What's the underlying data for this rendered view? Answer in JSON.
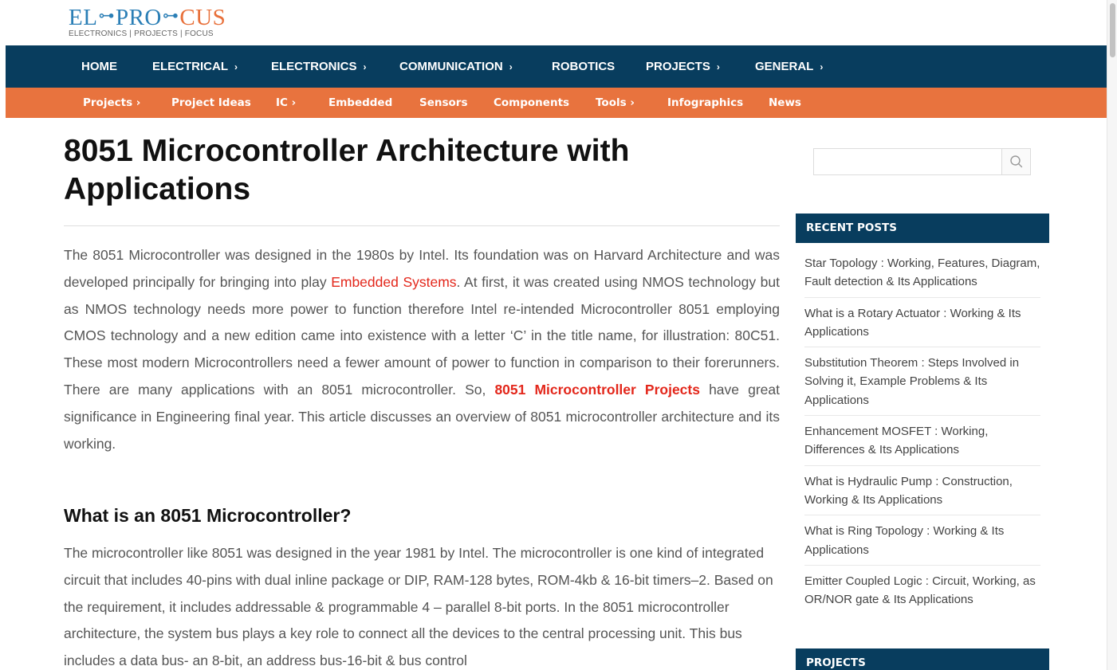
{
  "logo": {
    "part1": "EL",
    "part2": "PRO",
    "part3": "CUS",
    "tagline": "ELECTRONICS | PROJECTS | FOCUS"
  },
  "main_nav": {
    "items": [
      {
        "label": "HOME",
        "has_submenu": false
      },
      {
        "label": "ELECTRICAL",
        "has_submenu": true
      },
      {
        "label": "ELECTRONICS",
        "has_submenu": true
      },
      {
        "label": "COMMUNICATION",
        "has_submenu": true
      },
      {
        "label": "ROBOTICS",
        "has_submenu": false
      },
      {
        "label": "PROJECTS",
        "has_submenu": true
      },
      {
        "label": "GENERAL",
        "has_submenu": true
      }
    ],
    "chevron": "›"
  },
  "sub_nav": {
    "items": [
      {
        "label": "Projects ›"
      },
      {
        "label": "Project Ideas"
      },
      {
        "label": "IC ›"
      },
      {
        "label": "Embedded"
      },
      {
        "label": "Sensors"
      },
      {
        "label": "Components"
      },
      {
        "label": "Tools ›"
      },
      {
        "label": "Infographics"
      },
      {
        "label": "News"
      }
    ]
  },
  "article": {
    "title": "8051 Microcontroller Architecture with Applications",
    "intro": {
      "text1": "The 8051 Microcontroller was designed in the 1980s by Intel. Its foundation was on Harvard Architecture and was developed principally for bringing into play ",
      "link1": "Embedded Systems",
      "text2": ". At first, it was created using NMOS technology but as NMOS technology needs more power to function therefore Intel re-intended Microcontroller 8051 employing CMOS technology and a new edition came into existence with a letter ‘C’ in the title name, for illustration: 80C51. These most modern Microcontrollers need a fewer amount of power to function in comparison to their forerunners. There are many applications with an 8051 microcontroller. So, ",
      "link2": "8051 Microcontroller Projects",
      "text3": " have great significance in Engineering final year. This article discusses an overview of 8051 microcontroller architecture and its working."
    },
    "section_heading": "What is an 8051 Microcontroller?",
    "section_text": "The microcontroller like 8051 was designed in the year 1981 by Intel. The microcontroller is one kind of integrated circuit that includes 40-pins with dual inline package or DIP, RAM-128 bytes, ROM-4kb & 16-bit timers–2. Based on the requirement, it includes addressable & programmable 4 – parallel 8-bit ports. In the 8051 microcontroller architecture, the system bus plays a key role to connect all the devices to the central processing unit. This bus includes a data bus- an 8-bit, an address bus-16-bit & bus control"
  },
  "sidebar": {
    "search": {
      "placeholder": "",
      "value": "",
      "icon": "search-icon"
    },
    "recent_posts_heading": "RECENT POSTS",
    "recent_posts": [
      "Star Topology : Working, Features, Diagram, Fault detection & Its Applications",
      "What is a Rotary Actuator : Working & Its Applications",
      "Substitution Theorem : Steps Involved in Solving it, Example Problems & Its Applications",
      "Enhancement MOSFET : Working, Differences & Its Applications",
      "What is Hydraulic Pump : Construction, Working & Its Applications",
      "What is Ring Topology : Working & Its Applications",
      "Emitter Coupled Logic : Circuit, Working, as OR/NOR gate & Its Applications"
    ],
    "projects_heading": "PROJECTS"
  },
  "colors": {
    "nav_blue": "#083d5e",
    "nav_orange": "#e8733e",
    "link_red": "#e3271b",
    "logo_blue": "#2b7fb6",
    "logo_orange": "#e8703a"
  }
}
